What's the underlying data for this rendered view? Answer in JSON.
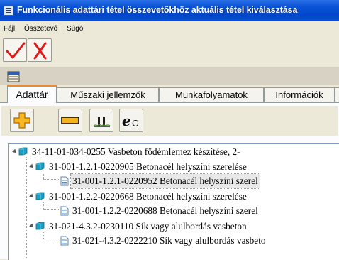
{
  "window": {
    "title": "Funkcionális adattári tétel összevetőkhöz aktuális tétel kiválasztása"
  },
  "menu": {
    "items": [
      "Fájl",
      "Összetevő",
      "Súgó"
    ]
  },
  "toolbar_main": {
    "ok_icon": "checkmark-icon",
    "cancel_icon": "x-icon",
    "ok_color": "#e01a1a",
    "cancel_color": "#e01a1a"
  },
  "tabs": [
    {
      "label": "Adattár",
      "active": true
    },
    {
      "label": "Műszaki jellemzők",
      "active": false
    },
    {
      "label": "Munkafolyamatok",
      "active": false
    },
    {
      "label": "Információk",
      "active": false
    }
  ],
  "toolbar_secondary": {
    "icons": [
      "add-icon",
      "collapse-icon",
      "chart-icon",
      "ec-icon"
    ],
    "ec_label": "C"
  },
  "tree": {
    "rows": [
      {
        "level": 0,
        "type": "folder",
        "expanded": true,
        "text": "34-11-01-034-0255 Vasbeton födémlemez készítése, 2-"
      },
      {
        "level": 1,
        "type": "folder",
        "expanded": true,
        "text": "31-001-1.2.1-0220905 Betonacél helyszíni szerelése"
      },
      {
        "level": 2,
        "type": "doc",
        "selected": true,
        "text": "31-001-1.2.1-0220952 Betonacél helyszíni szerel"
      },
      {
        "level": 1,
        "type": "folder",
        "expanded": true,
        "text": "31-001-1.2.2-0220668 Betonacél helyszíni szerelése"
      },
      {
        "level": 2,
        "type": "doc",
        "selected": false,
        "text": "31-001-1.2.2-0220688 Betonacél helyszíni szerel"
      },
      {
        "level": 1,
        "type": "folder",
        "expanded": true,
        "text": "31-021-4.3.2-0230110 Sík vagy alulbordás vasbeton"
      },
      {
        "level": 2,
        "type": "doc",
        "selected": false,
        "text": "31-021-4.3.2-0222210 Sík vagy alulbordás vasbeto"
      }
    ]
  }
}
